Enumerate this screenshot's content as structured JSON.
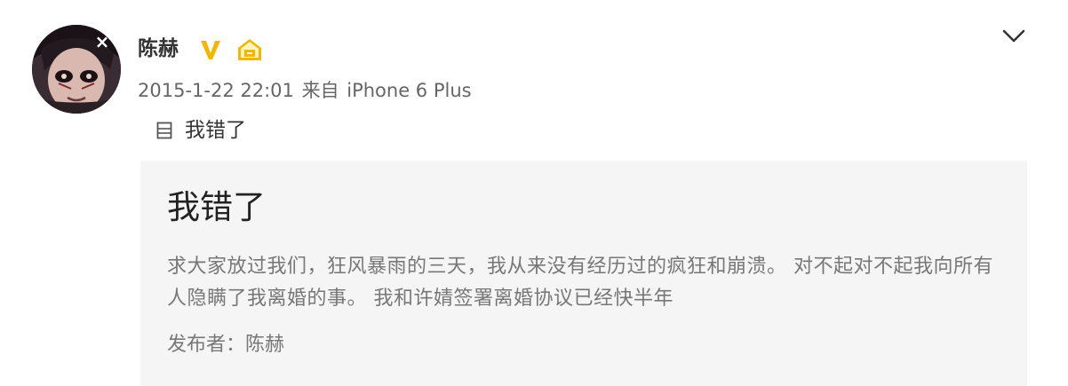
{
  "post": {
    "username": "陈赫",
    "timestamp": "2015-1-22 22:01",
    "source_prefix": "来自",
    "source_device": "iPhone 6 Plus",
    "avatar_badge": "×",
    "verified_icon": "verified-v-icon",
    "level_icon": "member-level-icon",
    "menu_icon": "chevron-down-icon",
    "accent_color": "#f0b800"
  },
  "article_link": {
    "icon": "document-icon",
    "label": "我错了"
  },
  "card": {
    "title": "我错了",
    "excerpt": "求大家放过我们，狂风暴雨的三天，我从来没有经历过的疯狂和崩溃。 对不起对不起我向所有人隐瞒了我离婚的事。 我和许婧签署离婚协议已经快半年",
    "author_label": "发布者：陈赫"
  }
}
